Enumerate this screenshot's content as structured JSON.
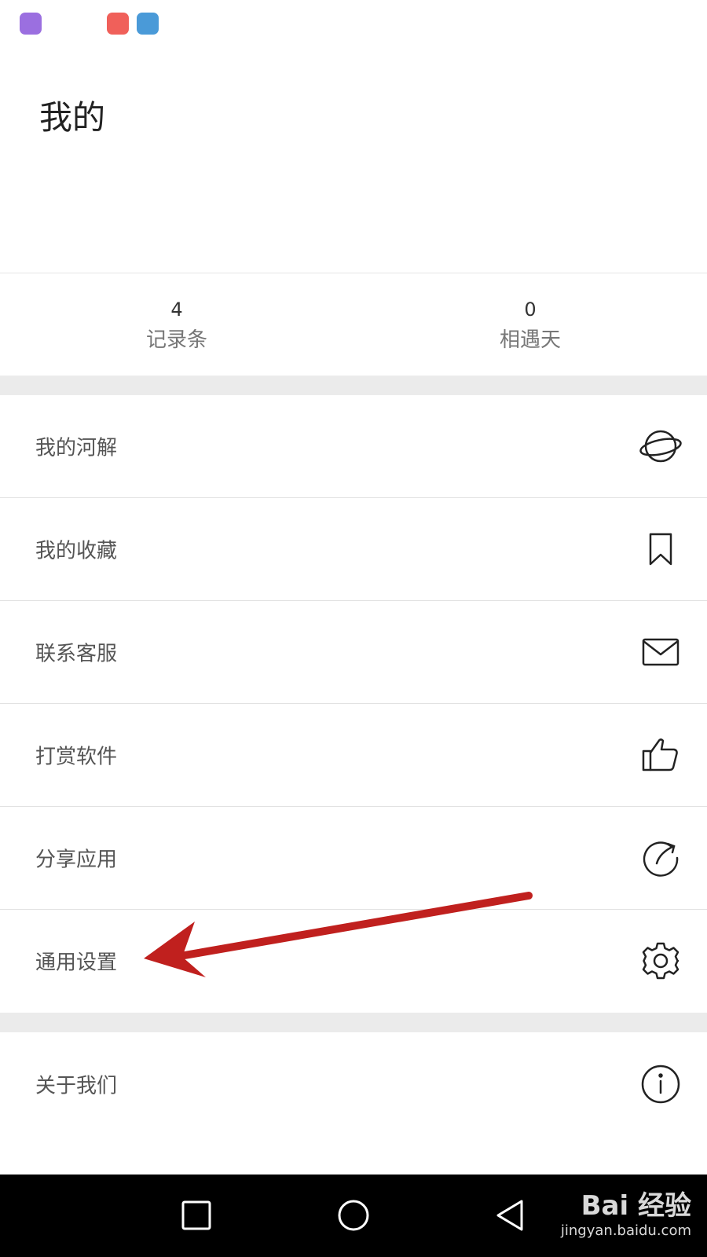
{
  "status_bar": {
    "icons": [
      "app-icon-purple",
      "app-icon-red",
      "shield-app-icon"
    ]
  },
  "header": {
    "title": "我的"
  },
  "stats": [
    {
      "value": "4",
      "label": "记录条"
    },
    {
      "value": "0",
      "label": "相遇天"
    }
  ],
  "menu": {
    "items": [
      {
        "label": "我的河解",
        "icon": "planet-icon"
      },
      {
        "label": "我的收藏",
        "icon": "bookmark-icon"
      },
      {
        "label": "联系客服",
        "icon": "mail-icon"
      },
      {
        "label": "打赏软件",
        "icon": "thumbs-up-icon"
      },
      {
        "label": "分享应用",
        "icon": "share-icon"
      },
      {
        "label": "通用设置",
        "icon": "gear-icon"
      }
    ],
    "about": {
      "label": "关于我们",
      "icon": "info-icon"
    }
  },
  "nav_bar": {
    "buttons": [
      "recent-apps-icon",
      "home-icon",
      "back-icon"
    ]
  },
  "watermark": {
    "main": "Bai 经验",
    "sub": "jingyan.baidu.com"
  },
  "colors": {
    "annotation_arrow": "#c0201e",
    "section_gap": "#ebebeb"
  }
}
